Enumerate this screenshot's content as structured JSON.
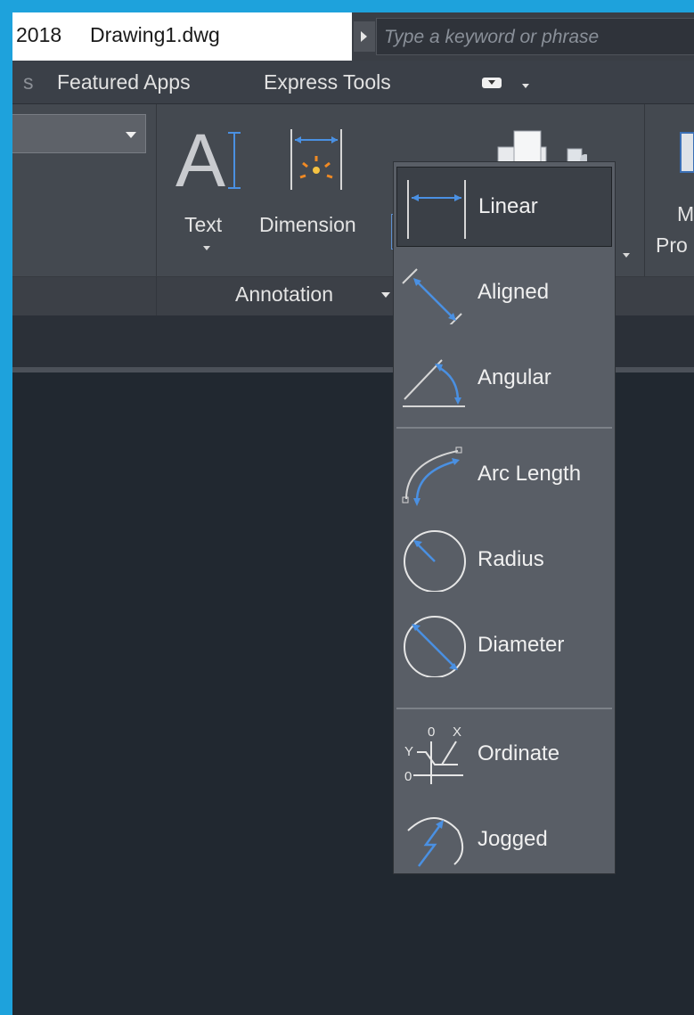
{
  "titlebar": {
    "version_suffix": "2018",
    "filename": "Drawing1.dwg",
    "search_placeholder": "Type a keyword or phrase"
  },
  "ribbon_tabs": {
    "partial_tab": "s",
    "featured_apps": "Featured Apps",
    "express_tools": "Express Tools"
  },
  "ribbon": {
    "text_button": "Text",
    "dimension_button": "Dimension",
    "multileader_partial_1": "M",
    "multileader_partial_2": "Pro",
    "annotation_panel": "Annotation"
  },
  "dimension_menu": {
    "items": [
      {
        "label": "Linear",
        "icon": "linear-dimension-icon",
        "selected": true
      },
      {
        "label": "Aligned",
        "icon": "aligned-dimension-icon"
      },
      {
        "label": "Angular",
        "icon": "angular-dimension-icon"
      },
      {
        "label": "Arc Length",
        "icon": "arc-length-dimension-icon"
      },
      {
        "label": "Radius",
        "icon": "radius-dimension-icon"
      },
      {
        "label": "Diameter",
        "icon": "diameter-dimension-icon"
      },
      {
        "label": "Ordinate",
        "icon": "ordinate-dimension-icon"
      },
      {
        "label": "Jogged",
        "icon": "jogged-dimension-icon"
      }
    ],
    "ordinate_icon_letters": {
      "x": "X",
      "y": "Y",
      "zero": "0"
    }
  },
  "colors": {
    "accent_blue": "#4a90e2",
    "window_background": "#1ea2dc",
    "drawing_area": "#212830"
  }
}
